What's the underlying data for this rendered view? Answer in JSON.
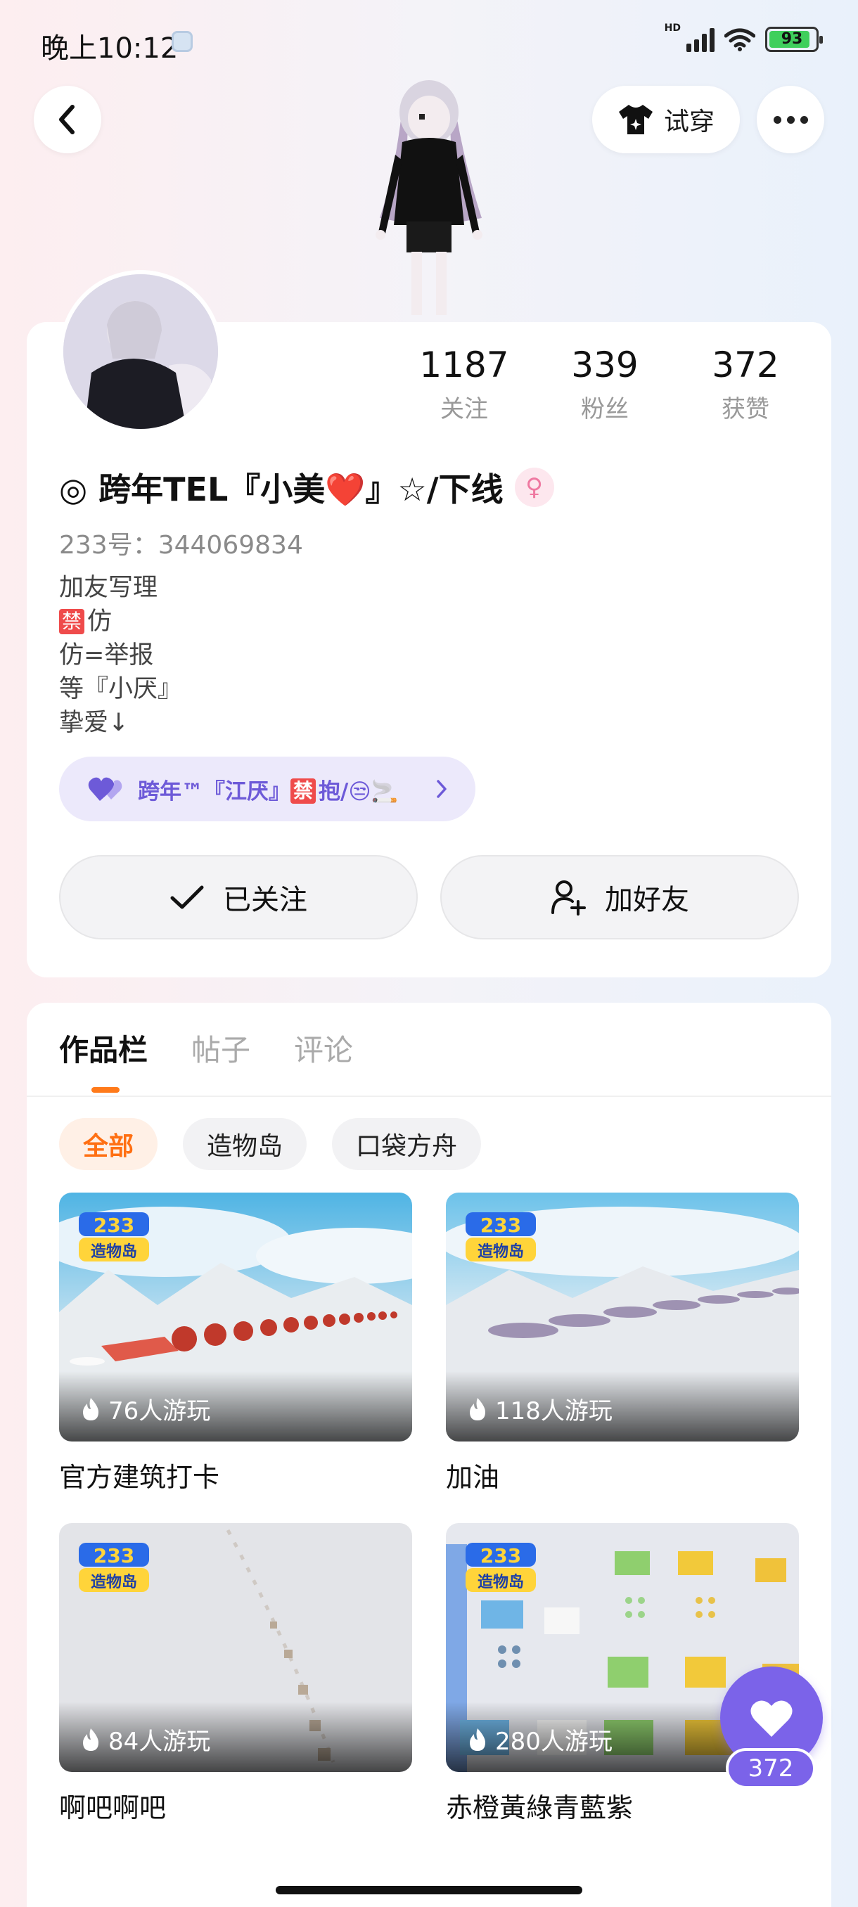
{
  "status_bar": {
    "time": "晚上10:12",
    "battery": "93",
    "net": "HD"
  },
  "header": {
    "tryon_label": "试穿"
  },
  "stats": [
    {
      "value": "1187",
      "label": "关注"
    },
    {
      "value": "339",
      "label": "粉丝"
    },
    {
      "value": "372",
      "label": "获赞"
    }
  ],
  "profile": {
    "name": "◎ 跨年TEL『小美❤️』☆/下线",
    "gender_symbol": "♀",
    "user_id": "233号：344069834",
    "bio": [
      {
        "tag": "",
        "text": "加友写理"
      },
      {
        "tag": "禁",
        "text": "仿"
      },
      {
        "tag": "",
        "text": "仿=举报"
      },
      {
        "tag": "",
        "text": "等『小厌』"
      },
      {
        "tag": "",
        "text": "挚爱↓"
      }
    ],
    "relation": {
      "text": "跨年™『江厌』",
      "tag": "禁",
      "suffix": "抱/😒🚬"
    }
  },
  "actions": {
    "follow_label": "已关注",
    "add_friend_label": "加好友"
  },
  "tabs": [
    "作品栏",
    "帖子",
    "评论"
  ],
  "filters": [
    "全部",
    "造物岛",
    "口袋方舟"
  ],
  "works": [
    {
      "plays": "76人游玩",
      "title": "官方建筑打卡"
    },
    {
      "plays": "118人游玩",
      "title": "加油"
    },
    {
      "plays": "84人游玩",
      "title": "啊吧啊吧"
    },
    {
      "plays": "280人游玩",
      "title": "赤橙黃綠青藍紫"
    }
  ],
  "game_logo": {
    "line1": "233",
    "line2": "造物岛"
  },
  "like_fab": {
    "count": "372"
  },
  "colors": {
    "accent": "#ff7a1a",
    "purple": "#7b63e9",
    "chip_bg": "#ece9fb"
  }
}
